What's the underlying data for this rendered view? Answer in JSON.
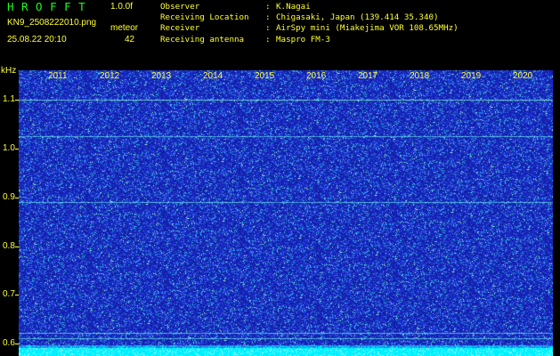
{
  "app": {
    "logo_text": "HROFFT",
    "version": "1.0.0f",
    "filename": "KN9_2508222010.png",
    "mode": "meteor",
    "timestamp": "25.08.22 20:10",
    "count": "42"
  },
  "info": [
    {
      "key": "Observer",
      "value": "K.Nagai"
    },
    {
      "key": "Receiving Location",
      "value": "Chigasaki, Japan (139.414 35.340)"
    },
    {
      "key": "Receiver",
      "value": "AirSpy mini (Miakejima VOR 108.65MHz)"
    },
    {
      "key": "Receiving antenna",
      "value": "Maspro FM-3"
    }
  ],
  "colors": {
    "text": "#ffff33",
    "logo": "#18ff18",
    "background": "#000000",
    "spectrogram_base": "#1a2a9a",
    "noise_floor": "#00ffff"
  },
  "chart_data": {
    "type": "heatmap",
    "y_unit": "kHz",
    "y_ticks": [
      "1.1",
      "1.0",
      "0.9",
      "0.8",
      "0.7",
      "0.6"
    ],
    "y_range": [
      0.575,
      1.16
    ],
    "x_labels": [
      "2011",
      "2012",
      "2013",
      "2014",
      "2015",
      "2016",
      "2017",
      "2018",
      "2019",
      "2020"
    ],
    "carrier_lines_khz": [
      1.1,
      1.025,
      0.89,
      0.622,
      0.611
    ]
  }
}
